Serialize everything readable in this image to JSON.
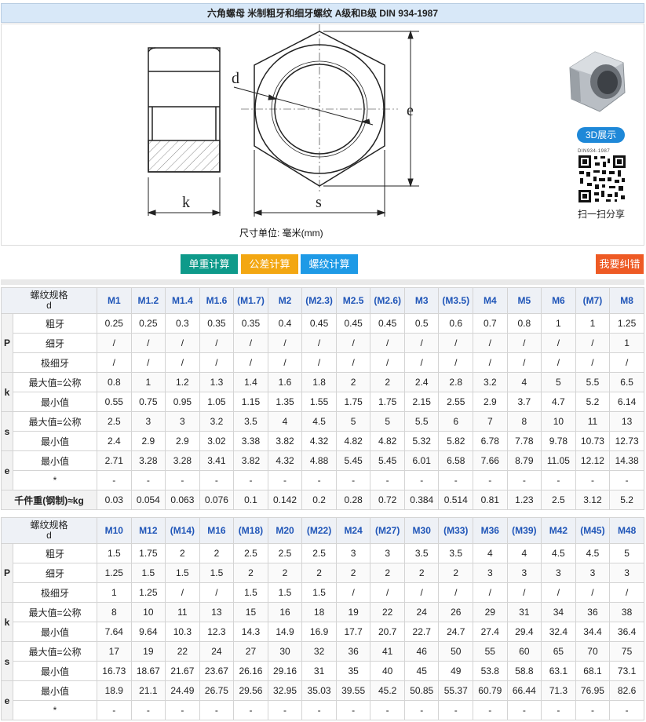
{
  "title": "六角螺母 米制粗牙和细牙螺纹 A级和B级 DIN 934-1987",
  "drawing": {
    "label_d": "d",
    "label_e": "e",
    "label_k": "k",
    "label_s": "s",
    "units": "尺寸单位: 毫米(mm)"
  },
  "sidebar": {
    "btn_3d": "3D展示",
    "qr_caption": "DIN934-1987",
    "scan_label": "扫一扫分享"
  },
  "buttons": {
    "unit_weight": "单重计算",
    "tolerance": "公差计算",
    "thread": "螺纹计算",
    "report_error": "我要纠错"
  },
  "labels": {
    "size_header": [
      "螺纹规格",
      "d"
    ],
    "groups": {
      "P": "P",
      "k": "k",
      "s": "s",
      "e": "e"
    },
    "coarse": "粗牙",
    "fine": "细牙",
    "extra_fine": "极细牙",
    "max_nominal": "最大值=公称",
    "min": "最小值",
    "star": "*",
    "mass": "千件重(钢制)≈kg"
  },
  "table1": {
    "sizes": [
      "M1",
      "M1.2",
      "M1.4",
      "M1.6",
      "(M1.7)",
      "M2",
      "(M2.3)",
      "M2.5",
      "(M2.6)",
      "M3",
      "(M3.5)",
      "M4",
      "M5",
      "M6",
      "(M7)",
      "M8"
    ],
    "P_coarse": [
      "0.25",
      "0.25",
      "0.3",
      "0.35",
      "0.35",
      "0.4",
      "0.45",
      "0.45",
      "0.45",
      "0.5",
      "0.6",
      "0.7",
      "0.8",
      "1",
      "1",
      "1.25"
    ],
    "P_fine": [
      "/",
      "/",
      "/",
      "/",
      "/",
      "/",
      "/",
      "/",
      "/",
      "/",
      "/",
      "/",
      "/",
      "/",
      "/",
      "1"
    ],
    "P_extra_fine": [
      "/",
      "/",
      "/",
      "/",
      "/",
      "/",
      "/",
      "/",
      "/",
      "/",
      "/",
      "/",
      "/",
      "/",
      "/",
      "/"
    ],
    "k_max": [
      "0.8",
      "1",
      "1.2",
      "1.3",
      "1.4",
      "1.6",
      "1.8",
      "2",
      "2",
      "2.4",
      "2.8",
      "3.2",
      "4",
      "5",
      "5.5",
      "6.5"
    ],
    "k_min": [
      "0.55",
      "0.75",
      "0.95",
      "1.05",
      "1.15",
      "1.35",
      "1.55",
      "1.75",
      "1.75",
      "2.15",
      "2.55",
      "2.9",
      "3.7",
      "4.7",
      "5.2",
      "6.14"
    ],
    "s_max": [
      "2.5",
      "3",
      "3",
      "3.2",
      "3.5",
      "4",
      "4.5",
      "5",
      "5",
      "5.5",
      "6",
      "7",
      "8",
      "10",
      "11",
      "13"
    ],
    "s_min": [
      "2.4",
      "2.9",
      "2.9",
      "3.02",
      "3.38",
      "3.82",
      "4.32",
      "4.82",
      "4.82",
      "5.32",
      "5.82",
      "6.78",
      "7.78",
      "9.78",
      "10.73",
      "12.73"
    ],
    "e_min": [
      "2.71",
      "3.28",
      "3.28",
      "3.41",
      "3.82",
      "4.32",
      "4.88",
      "5.45",
      "5.45",
      "6.01",
      "6.58",
      "7.66",
      "8.79",
      "11.05",
      "12.12",
      "14.38"
    ],
    "star": [
      "-",
      "-",
      "-",
      "-",
      "-",
      "-",
      "-",
      "-",
      "-",
      "-",
      "-",
      "-",
      "-",
      "-",
      "-",
      "-"
    ],
    "mass": [
      "0.03",
      "0.054",
      "0.063",
      "0.076",
      "0.1",
      "0.142",
      "0.2",
      "0.28",
      "0.72",
      "0.384",
      "0.514",
      "0.81",
      "1.23",
      "2.5",
      "3.12",
      "5.2"
    ]
  },
  "table2": {
    "sizes": [
      "M10",
      "M12",
      "(M14)",
      "M16",
      "(M18)",
      "M20",
      "(M22)",
      "M24",
      "(M27)",
      "M30",
      "(M33)",
      "M36",
      "(M39)",
      "M42",
      "(M45)",
      "M48"
    ],
    "P_coarse": [
      "1.5",
      "1.75",
      "2",
      "2",
      "2.5",
      "2.5",
      "2.5",
      "3",
      "3",
      "3.5",
      "3.5",
      "4",
      "4",
      "4.5",
      "4.5",
      "5"
    ],
    "P_fine": [
      "1.25",
      "1.5",
      "1.5",
      "1.5",
      "2",
      "2",
      "2",
      "2",
      "2",
      "2",
      "2",
      "3",
      "3",
      "3",
      "3",
      "3"
    ],
    "P_extra_fine": [
      "1",
      "1.25",
      "/",
      "/",
      "1.5",
      "1.5",
      "1.5",
      "/",
      "/",
      "/",
      "/",
      "/",
      "/",
      "/",
      "/",
      "/"
    ],
    "k_max": [
      "8",
      "10",
      "11",
      "13",
      "15",
      "16",
      "18",
      "19",
      "22",
      "24",
      "26",
      "29",
      "31",
      "34",
      "36",
      "38"
    ],
    "k_min": [
      "7.64",
      "9.64",
      "10.3",
      "12.3",
      "14.3",
      "14.9",
      "16.9",
      "17.7",
      "20.7",
      "22.7",
      "24.7",
      "27.4",
      "29.4",
      "32.4",
      "34.4",
      "36.4"
    ],
    "s_max": [
      "17",
      "19",
      "22",
      "24",
      "27",
      "30",
      "32",
      "36",
      "41",
      "46",
      "50",
      "55",
      "60",
      "65",
      "70",
      "75"
    ],
    "s_min": [
      "16.73",
      "18.67",
      "21.67",
      "23.67",
      "26.16",
      "29.16",
      "31",
      "35",
      "40",
      "45",
      "49",
      "53.8",
      "58.8",
      "63.1",
      "68.1",
      "73.1"
    ],
    "e_min": [
      "18.9",
      "21.1",
      "24.49",
      "26.75",
      "29.56",
      "32.95",
      "35.03",
      "39.55",
      "45.2",
      "50.85",
      "55.37",
      "60.79",
      "66.44",
      "71.3",
      "76.95",
      "82.6"
    ],
    "star": [
      "-",
      "-",
      "-",
      "-",
      "-",
      "-",
      "-",
      "-",
      "-",
      "-",
      "-",
      "-",
      "-",
      "-",
      "-",
      "-"
    ]
  }
}
